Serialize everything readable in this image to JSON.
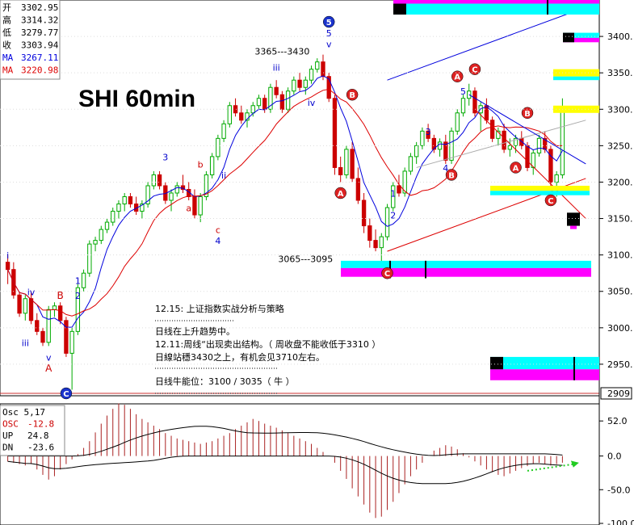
{
  "title": "SHI 60min",
  "colors": {
    "up": "#00aa00",
    "down": "#cc0000",
    "ma1": "#0000dd",
    "ma2": "#dd0000",
    "cyan": "#00ffff",
    "magenta": "#ff00ff",
    "yellow": "#ffff00",
    "black": "#000000"
  },
  "info_box": [
    {
      "label": "开",
      "value": "3302.95",
      "color": "#000000"
    },
    {
      "label": "高",
      "value": "3314.32",
      "color": "#000000"
    },
    {
      "label": "低",
      "value": "3279.77",
      "color": "#000000"
    },
    {
      "label": "收",
      "value": "3303.94",
      "color": "#000000"
    },
    {
      "label": "MA",
      "value": "3267.11",
      "color": "#0000dd"
    },
    {
      "label": "MA",
      "value": "3220.98",
      "color": "#dd0000"
    }
  ],
  "osc_box": [
    {
      "label": "Osc 5,17",
      "value": "",
      "color": "#000000"
    },
    {
      "label": "OSC",
      "value": "-12.8",
      "color": "#cc0000"
    },
    {
      "label": "UP",
      "value": "24.8",
      "color": "#000000"
    },
    {
      "label": "DN",
      "value": "-23.6",
      "color": "#000000"
    }
  ],
  "notes": [
    "12.15: 上证指数实战分析与策略",
    "日线在上升趋势中。",
    "12.11:周线“出现卖出结构。（ 周收盘不能收低于3310 ）",
    "日線站穩3430之上，有机会见3710左右。",
    "日线牛能位：3100 / 3035（ 牛 ）"
  ],
  "chart_data": {
    "type": "candlestick",
    "title": "SHI 60min",
    "ylim": [
      2910,
      3450
    ],
    "yticks": [
      "3400.",
      "3350.",
      "3300.",
      "3250.",
      "3200.",
      "3150.",
      "3100.",
      "3050.",
      "3000.",
      "2950."
    ],
    "current_price_label": "2909",
    "candles": [
      {
        "o": 3090,
        "h": 3100,
        "l": 3060,
        "c": 3080
      },
      {
        "o": 3080,
        "h": 3090,
        "l": 3040,
        "c": 3045
      },
      {
        "o": 3045,
        "h": 3050,
        "l": 3015,
        "c": 3020
      },
      {
        "o": 3020,
        "h": 3045,
        "l": 3010,
        "c": 3040
      },
      {
        "o": 3040,
        "h": 3050,
        "l": 3005,
        "c": 3010
      },
      {
        "o": 3010,
        "h": 3020,
        "l": 2990,
        "c": 2995
      },
      {
        "o": 2995,
        "h": 3000,
        "l": 2975,
        "c": 2980
      },
      {
        "o": 2980,
        "h": 3030,
        "l": 2975,
        "c": 3025
      },
      {
        "o": 3025,
        "h": 3035,
        "l": 3015,
        "c": 3030
      },
      {
        "o": 3030,
        "h": 3035,
        "l": 3005,
        "c": 3010
      },
      {
        "o": 3010,
        "h": 3015,
        "l": 2960,
        "c": 2965
      },
      {
        "o": 2965,
        "h": 3000,
        "l": 2915,
        "c": 2995
      },
      {
        "o": 2995,
        "h": 3060,
        "l": 2990,
        "c": 3055
      },
      {
        "o": 3055,
        "h": 3080,
        "l": 3050,
        "c": 3075
      },
      {
        "o": 3075,
        "h": 3120,
        "l": 3070,
        "c": 3115
      },
      {
        "o": 3115,
        "h": 3125,
        "l": 3105,
        "c": 3120
      },
      {
        "o": 3120,
        "h": 3140,
        "l": 3115,
        "c": 3135
      },
      {
        "o": 3135,
        "h": 3150,
        "l": 3130,
        "c": 3145
      },
      {
        "o": 3145,
        "h": 3165,
        "l": 3140,
        "c": 3160
      },
      {
        "o": 3160,
        "h": 3175,
        "l": 3150,
        "c": 3170
      },
      {
        "o": 3170,
        "h": 3185,
        "l": 3160,
        "c": 3180
      },
      {
        "o": 3180,
        "h": 3185,
        "l": 3165,
        "c": 3170
      },
      {
        "o": 3170,
        "h": 3180,
        "l": 3155,
        "c": 3160
      },
      {
        "o": 3160,
        "h": 3175,
        "l": 3150,
        "c": 3170
      },
      {
        "o": 3170,
        "h": 3200,
        "l": 3165,
        "c": 3195
      },
      {
        "o": 3195,
        "h": 3215,
        "l": 3190,
        "c": 3210
      },
      {
        "o": 3210,
        "h": 3215,
        "l": 3190,
        "c": 3195
      },
      {
        "o": 3195,
        "h": 3200,
        "l": 3170,
        "c": 3175
      },
      {
        "o": 3175,
        "h": 3190,
        "l": 3160,
        "c": 3185
      },
      {
        "o": 3185,
        "h": 3200,
        "l": 3180,
        "c": 3195
      },
      {
        "o": 3195,
        "h": 3210,
        "l": 3185,
        "c": 3190
      },
      {
        "o": 3190,
        "h": 3200,
        "l": 3175,
        "c": 3180
      },
      {
        "o": 3180,
        "h": 3190,
        "l": 3150,
        "c": 3155
      },
      {
        "o": 3155,
        "h": 3185,
        "l": 3145,
        "c": 3180
      },
      {
        "o": 3180,
        "h": 3215,
        "l": 3175,
        "c": 3210
      },
      {
        "o": 3210,
        "h": 3240,
        "l": 3205,
        "c": 3235
      },
      {
        "o": 3235,
        "h": 3265,
        "l": 3230,
        "c": 3260
      },
      {
        "o": 3260,
        "h": 3285,
        "l": 3255,
        "c": 3280
      },
      {
        "o": 3280,
        "h": 3310,
        "l": 3275,
        "c": 3305
      },
      {
        "o": 3305,
        "h": 3315,
        "l": 3290,
        "c": 3295
      },
      {
        "o": 3295,
        "h": 3305,
        "l": 3280,
        "c": 3285
      },
      {
        "o": 3285,
        "h": 3300,
        "l": 3275,
        "c": 3295
      },
      {
        "o": 3295,
        "h": 3310,
        "l": 3290,
        "c": 3305
      },
      {
        "o": 3305,
        "h": 3320,
        "l": 3300,
        "c": 3315
      },
      {
        "o": 3315,
        "h": 3320,
        "l": 3295,
        "c": 3300
      },
      {
        "o": 3300,
        "h": 3335,
        "l": 3295,
        "c": 3330
      },
      {
        "o": 3330,
        "h": 3340,
        "l": 3315,
        "c": 3320
      },
      {
        "o": 3320,
        "h": 3325,
        "l": 3295,
        "c": 3300
      },
      {
        "o": 3300,
        "h": 3330,
        "l": 3295,
        "c": 3325
      },
      {
        "o": 3325,
        "h": 3345,
        "l": 3320,
        "c": 3340
      },
      {
        "o": 3340,
        "h": 3350,
        "l": 3325,
        "c": 3330
      },
      {
        "o": 3330,
        "h": 3345,
        "l": 3320,
        "c": 3340
      },
      {
        "o": 3340,
        "h": 3360,
        "l": 3335,
        "c": 3355
      },
      {
        "o": 3355,
        "h": 3370,
        "l": 3350,
        "c": 3365
      },
      {
        "o": 3365,
        "h": 3375,
        "l": 3340,
        "c": 3345
      },
      {
        "o": 3345,
        "h": 3350,
        "l": 3310,
        "c": 3315
      },
      {
        "o": 3315,
        "h": 3320,
        "l": 3210,
        "c": 3220
      },
      {
        "o": 3220,
        "h": 3235,
        "l": 3200,
        "c": 3210
      },
      {
        "o": 3210,
        "h": 3250,
        "l": 3205,
        "c": 3245
      },
      {
        "o": 3245,
        "h": 3255,
        "l": 3200,
        "c": 3205
      },
      {
        "o": 3205,
        "h": 3220,
        "l": 3170,
        "c": 3175
      },
      {
        "o": 3175,
        "h": 3185,
        "l": 3130,
        "c": 3140
      },
      {
        "o": 3140,
        "h": 3150,
        "l": 3110,
        "c": 3120
      },
      {
        "o": 3120,
        "h": 3135,
        "l": 3105,
        "c": 3110
      },
      {
        "o": 3110,
        "h": 3130,
        "l": 3085,
        "c": 3125
      },
      {
        "o": 3125,
        "h": 3170,
        "l": 3120,
        "c": 3165
      },
      {
        "o": 3165,
        "h": 3200,
        "l": 3160,
        "c": 3195
      },
      {
        "o": 3195,
        "h": 3210,
        "l": 3180,
        "c": 3185
      },
      {
        "o": 3185,
        "h": 3220,
        "l": 3180,
        "c": 3215
      },
      {
        "o": 3215,
        "h": 3240,
        "l": 3210,
        "c": 3235
      },
      {
        "o": 3235,
        "h": 3255,
        "l": 3225,
        "c": 3250
      },
      {
        "o": 3250,
        "h": 3275,
        "l": 3245,
        "c": 3270
      },
      {
        "o": 3270,
        "h": 3280,
        "l": 3255,
        "c": 3260
      },
      {
        "o": 3260,
        "h": 3265,
        "l": 3240,
        "c": 3245
      },
      {
        "o": 3245,
        "h": 3260,
        "l": 3235,
        "c": 3255
      },
      {
        "o": 3255,
        "h": 3265,
        "l": 3225,
        "c": 3230
      },
      {
        "o": 3230,
        "h": 3275,
        "l": 3225,
        "c": 3270
      },
      {
        "o": 3270,
        "h": 3300,
        "l": 3265,
        "c": 3295
      },
      {
        "o": 3295,
        "h": 3320,
        "l": 3290,
        "c": 3315
      },
      {
        "o": 3315,
        "h": 3335,
        "l": 3305,
        "c": 3325
      },
      {
        "o": 3325,
        "h": 3330,
        "l": 3290,
        "c": 3295
      },
      {
        "o": 3295,
        "h": 3310,
        "l": 3270,
        "c": 3305
      },
      {
        "o": 3305,
        "h": 3315,
        "l": 3280,
        "c": 3285
      },
      {
        "o": 3285,
        "h": 3290,
        "l": 3255,
        "c": 3260
      },
      {
        "o": 3260,
        "h": 3275,
        "l": 3250,
        "c": 3270
      },
      {
        "o": 3270,
        "h": 3280,
        "l": 3240,
        "c": 3245
      },
      {
        "o": 3245,
        "h": 3260,
        "l": 3235,
        "c": 3250
      },
      {
        "o": 3250,
        "h": 3265,
        "l": 3240,
        "c": 3260
      },
      {
        "o": 3260,
        "h": 3270,
        "l": 3245,
        "c": 3250
      },
      {
        "o": 3250,
        "h": 3255,
        "l": 3215,
        "c": 3220
      },
      {
        "o": 3220,
        "h": 3245,
        "l": 3210,
        "c": 3240
      },
      {
        "o": 3240,
        "h": 3265,
        "l": 3235,
        "c": 3260
      },
      {
        "o": 3260,
        "h": 3270,
        "l": 3240,
        "c": 3245
      },
      {
        "o": 3245,
        "h": 3250,
        "l": 3195,
        "c": 3200
      },
      {
        "o": 3200,
        "h": 3215,
        "l": 3180,
        "c": 3210
      },
      {
        "o": 3210,
        "h": 3315,
        "l": 3205,
        "c": 3304
      }
    ],
    "osc": [
      -8,
      -10,
      -12,
      -14,
      -12,
      -20,
      -28,
      -35,
      -30,
      -20,
      -12,
      -5,
      3,
      12,
      22,
      35,
      48,
      60,
      70,
      78,
      76,
      70,
      62,
      55,
      50,
      45,
      40,
      34,
      30,
      26,
      24,
      22,
      20,
      18,
      20,
      22,
      26,
      30,
      34,
      40,
      45,
      50,
      55,
      52,
      48,
      45,
      42,
      38,
      34,
      30,
      26,
      22,
      18,
      12,
      6,
      0,
      -10,
      -22,
      -34,
      -48,
      -60,
      -72,
      -84,
      -92,
      -90,
      -80,
      -68,
      -55,
      -42,
      -30,
      -20,
      -10,
      0,
      8,
      12,
      16,
      14,
      10,
      4,
      -2,
      -8,
      -14,
      -20,
      -24,
      -28,
      -30,
      -26,
      -22,
      -18,
      -15,
      -12,
      -10,
      -12,
      -14,
      -12,
      -10
    ],
    "osc_ylim": [
      -100,
      75
    ],
    "osc_yticks": [
      "52.0",
      "0.0",
      "-50.0",
      "-100.0"
    ]
  },
  "annotations": [
    {
      "text": "3365---3430",
      "price": 3375,
      "idx": 47,
      "color": "#000000",
      "size": 11
    },
    {
      "text": "3065---3095",
      "price": 3090,
      "idx": 51,
      "color": "#000000",
      "size": 11
    },
    {
      "text": "v",
      "price": 3385,
      "idx": 55,
      "color": "#0000cc",
      "size": 11
    },
    {
      "text": "5",
      "price": 3400,
      "idx": 55,
      "color": "#0000cc",
      "size": 11
    },
    {
      "text": "iii",
      "price": 3353,
      "idx": 46,
      "color": "#0000cc",
      "size": 11
    },
    {
      "text": "iv",
      "price": 3305,
      "idx": 52,
      "color": "#0000cc",
      "size": 11
    },
    {
      "text": "3",
      "price": 3230,
      "idx": 27,
      "color": "#0000cc",
      "size": 11
    },
    {
      "text": "b",
      "price": 3220,
      "idx": 33,
      "color": "#cc0000",
      "size": 11
    },
    {
      "text": "a",
      "price": 3160,
      "idx": 31,
      "color": "#cc0000",
      "size": 11
    },
    {
      "text": "ii",
      "price": 3205,
      "idx": 37,
      "color": "#0000cc",
      "size": 11
    },
    {
      "text": "c",
      "price": 3130,
      "idx": 36,
      "color": "#cc0000",
      "size": 11
    },
    {
      "text": "4",
      "price": 3115,
      "idx": 36,
      "color": "#0000cc",
      "size": 11
    },
    {
      "text": "i",
      "price": 3095,
      "idx": 0,
      "color": "#0000cc",
      "size": 11
    },
    {
      "text": "iv",
      "price": 3045,
      "idx": 4,
      "color": "#0000cc",
      "size": 11
    },
    {
      "text": "iii",
      "price": 2975,
      "idx": 3,
      "color": "#0000cc",
      "size": 11
    },
    {
      "text": "v",
      "price": 2955,
      "idx": 7,
      "color": "#0000cc",
      "size": 11
    },
    {
      "text": "B",
      "price": 3040,
      "idx": 9,
      "color": "#cc0000",
      "size": 12
    },
    {
      "text": "A",
      "price": 2940,
      "idx": 7,
      "color": "#cc0000",
      "size": 12
    },
    {
      "text": "1",
      "price": 3060,
      "idx": 12,
      "color": "#0000cc",
      "size": 11
    },
    {
      "text": "2",
      "price": 3040,
      "idx": 12,
      "color": "#0000cc",
      "size": 11
    },
    {
      "text": "1",
      "price": 3180,
      "idx": 66,
      "color": "#0000cc",
      "size": 11
    },
    {
      "text": "2",
      "price": 3150,
      "idx": 66,
      "color": "#0000cc",
      "size": 11
    },
    {
      "text": "3",
      "price": 3265,
      "idx": 72,
      "color": "#0000cc",
      "size": 11
    },
    {
      "text": "4",
      "price": 3215,
      "idx": 75,
      "color": "#0000cc",
      "size": 11
    },
    {
      "text": "5",
      "price": 3320,
      "idx": 78,
      "color": "#0000cc",
      "size": 11
    }
  ],
  "circled": [
    {
      "text": "5",
      "price": 3420,
      "idx": 55,
      "fill": "#1a33cc"
    },
    {
      "text": "B",
      "price": 3320,
      "idx": 59,
      "fill": "#dd2222"
    },
    {
      "text": "A",
      "price": 3185,
      "idx": 57,
      "fill": "#dd2222"
    },
    {
      "text": "C",
      "price": 3075,
      "idx": 65,
      "fill": "#dd2222"
    },
    {
      "text": "A",
      "price": 3345,
      "idx": 77,
      "fill": "#dd2222"
    },
    {
      "text": "C",
      "price": 3355,
      "idx": 80,
      "fill": "#dd2222"
    },
    {
      "text": "B",
      "price": 3210,
      "idx": 76,
      "fill": "#dd2222"
    },
    {
      "text": "B",
      "price": 3295,
      "idx": 89,
      "fill": "#dd2222"
    },
    {
      "text": "A",
      "price": 3220,
      "idx": 87,
      "fill": "#dd2222"
    },
    {
      "text": "C",
      "price": 3175,
      "idx": 93,
      "fill": "#dd2222"
    },
    {
      "text": "C",
      "price": 2910,
      "idx": 10,
      "fill": "#1a33cc"
    }
  ]
}
